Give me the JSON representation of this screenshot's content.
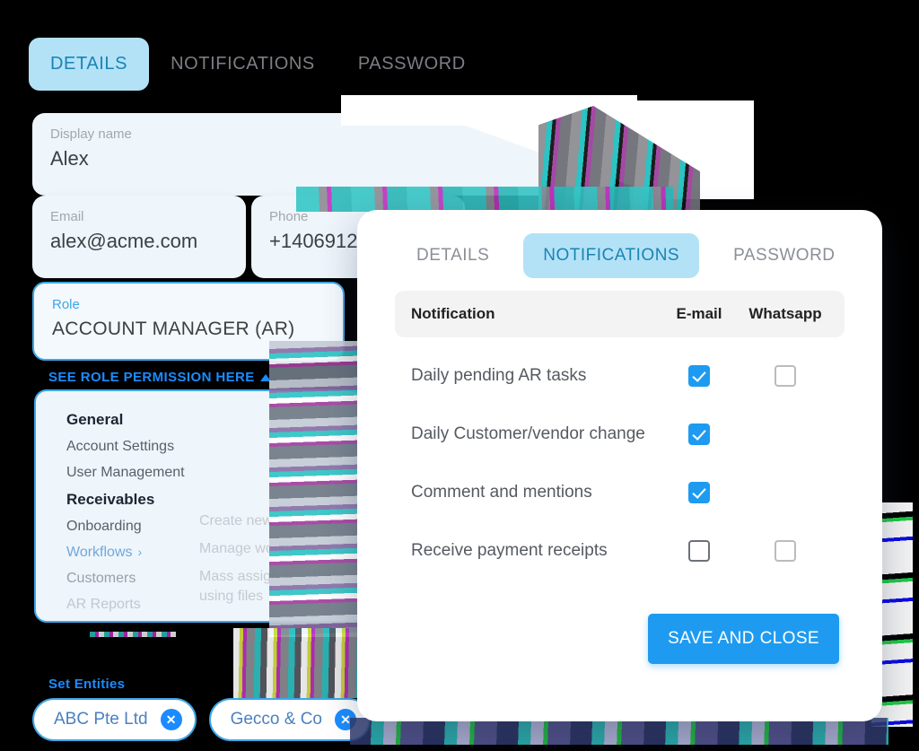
{
  "details_card": {
    "tabs": [
      {
        "label": "DETAILS",
        "active": true
      },
      {
        "label": "NOTIFICATIONS",
        "active": false
      },
      {
        "label": "PASSWORD",
        "active": false
      }
    ],
    "fields": {
      "display_name": {
        "label": "Display name",
        "value": "Alex",
        "placeholder": "Display name"
      },
      "email": {
        "label": "Email",
        "value": "alex@acme.com",
        "placeholder": "Email"
      },
      "phone": {
        "label": "Phone",
        "value": "+1406912",
        "placeholder": "Phone"
      },
      "role": {
        "label": "Role",
        "value": "ACCOUNT MANAGER (AR)",
        "placeholder": "Role"
      }
    },
    "permission_toggle": {
      "label": "SEE ROLE PERMISSION HERE",
      "icon": "chevron-up-icon"
    },
    "permissions": {
      "column_a": [
        {
          "label": "General",
          "type": "heading"
        },
        {
          "label": "Account Settings",
          "type": "item"
        },
        {
          "label": "User Management",
          "type": "item"
        },
        {
          "label": "Receivables",
          "type": "heading"
        },
        {
          "label": "Onboarding",
          "type": "item"
        },
        {
          "label": "Workflows",
          "type": "selected",
          "arrow": "›"
        },
        {
          "label": "Customers",
          "type": "dim"
        },
        {
          "label": "AR Reports",
          "type": "dimmer"
        }
      ],
      "column_b": [
        {
          "label": "Create new workflows"
        },
        {
          "label": "Manage workflows"
        },
        {
          "label": "Mass assign workflows using files"
        }
      ]
    },
    "entities": {
      "label": "Set Entities",
      "chips": [
        {
          "label": "ABC Pte Ltd",
          "remove_icon": "close-circle-icon"
        },
        {
          "label": "Gecco & Co",
          "remove_icon": "close-circle-icon"
        }
      ]
    }
  },
  "notifications_panel": {
    "tabs": [
      {
        "label": "DETAILS",
        "active": false
      },
      {
        "label": "NOTIFICATIONS",
        "active": true
      },
      {
        "label": "PASSWORD",
        "active": false
      }
    ],
    "table": {
      "headers": {
        "name": "Notification",
        "email": "E-mail",
        "whatsapp": "Whatsapp"
      },
      "rows": [
        {
          "name": "Daily pending AR tasks",
          "email": true,
          "whatsapp": false,
          "whatsapp_present": true
        },
        {
          "name": "Daily Customer/vendor change",
          "email": true,
          "whatsapp": false,
          "whatsapp_present": false
        },
        {
          "name": "Comment and mentions",
          "email": true,
          "whatsapp": false,
          "whatsapp_present": false
        },
        {
          "name": "Receive payment receipts",
          "email": false,
          "whatsapp": false,
          "whatsapp_present": true
        }
      ]
    },
    "save_button": {
      "label": "SAVE AND CLOSE"
    }
  },
  "colors": {
    "background": "#000000",
    "accent_blue": "#1e9bf0",
    "tab_active_bg": "#b3e2f7",
    "tab_active_text": "#1a84b3",
    "field_bg": "#eef5fb",
    "field_focus_border": "#3ea6e8",
    "link_blue": "#1a8cff",
    "table_header_bg": "#f3f3f3",
    "panel_bg": "#ffffff"
  }
}
